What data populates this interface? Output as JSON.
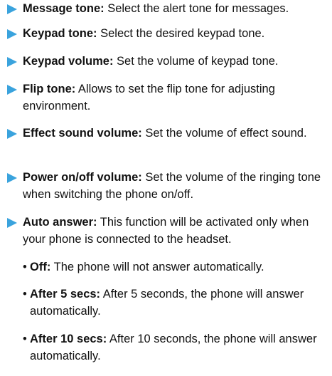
{
  "items": [
    {
      "term": "Message tone:",
      "desc": " Select the alert tone for messages."
    },
    {
      "term": "Keypad tone:",
      "desc": " Select the desired keypad tone."
    },
    {
      "term": "Keypad volume:",
      "desc": " Set the volume of keypad tone."
    },
    {
      "term": "Flip tone:",
      "desc": " Allows to set the flip tone for adjusting environment."
    },
    {
      "term": "Effect sound volume:",
      "desc": " Set the volume of effect sound."
    },
    {
      "term": "Power on/off volume:",
      "desc": " Set the volume of the ringing tone when switching the phone on/off."
    },
    {
      "term": "Auto answer:",
      "desc": " This function will be activated only when your phone is connected to the headset."
    }
  ],
  "sub_items": [
    {
      "term": "Off:",
      "desc": " The phone will not answer automatically."
    },
    {
      "term": "After 5 secs:",
      "desc": " After 5 seconds, the phone will answer automatically."
    },
    {
      "term": "After 10 secs:",
      "desc": " After 10 seconds, the phone will answer automatically."
    }
  ],
  "bullet_symbol": "•",
  "colors": {
    "arrow": "#3aa3dd",
    "text": "#111111"
  },
  "icons": {
    "item_marker": "right-triangle-arrow-icon"
  }
}
